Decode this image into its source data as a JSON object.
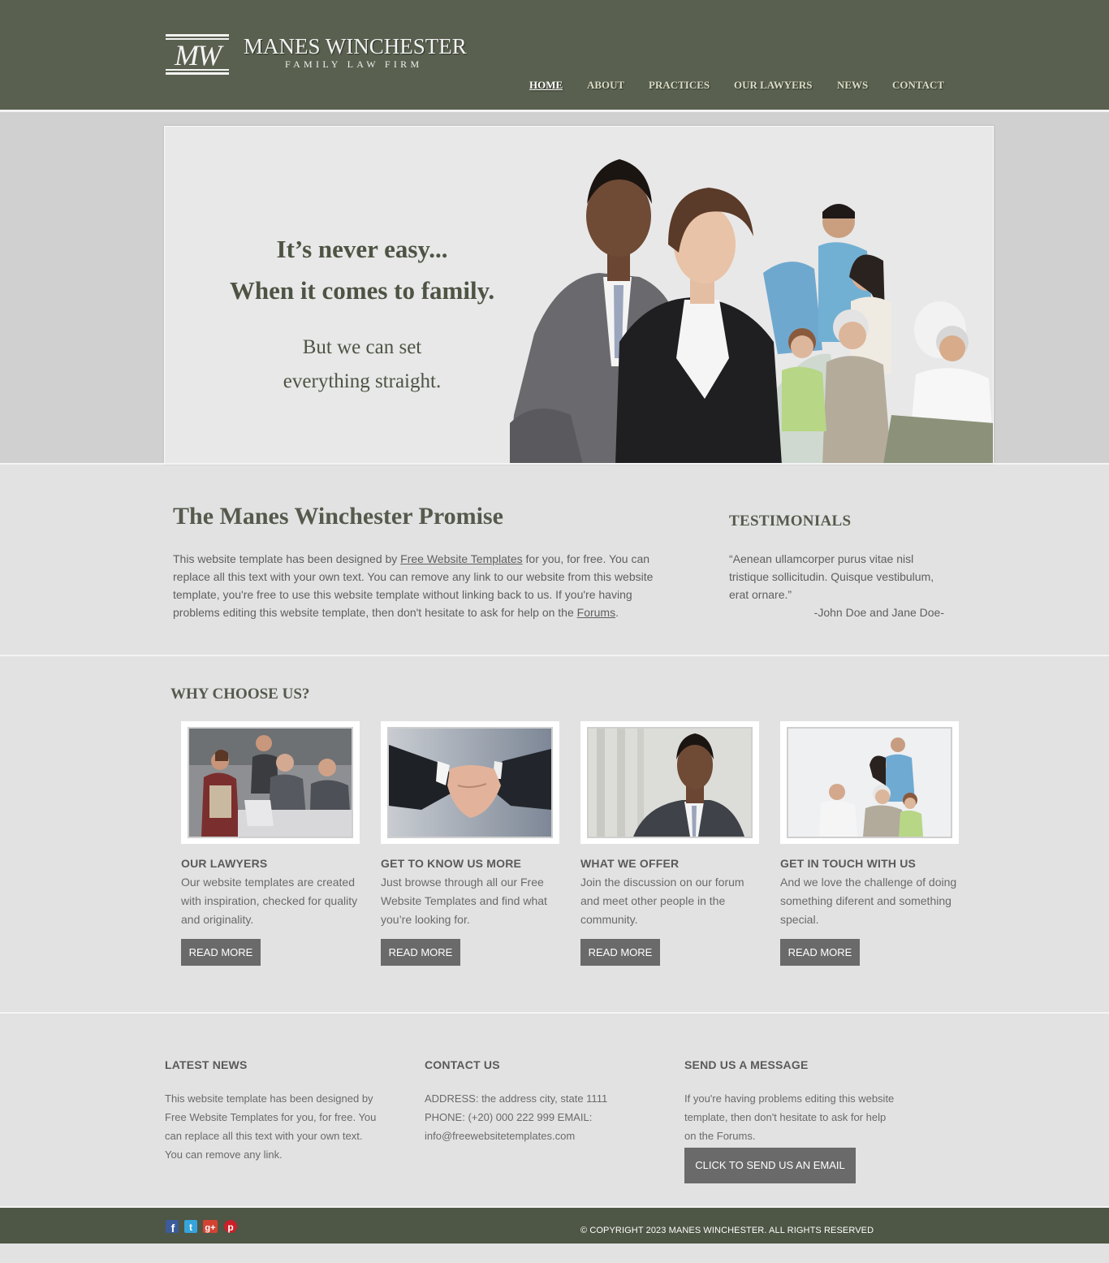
{
  "header": {
    "brand_name": "MANES WINCHESTER",
    "brand_tagline": "FAMILY LAW FIRM",
    "logo_monogram": "MW",
    "nav": [
      {
        "label": "HOME",
        "active": true
      },
      {
        "label": "ABOUT",
        "active": false
      },
      {
        "label": "PRACTICES",
        "active": false
      },
      {
        "label": "OUR LAWYERS",
        "active": false
      },
      {
        "label": "NEWS",
        "active": false
      },
      {
        "label": "CONTACT",
        "active": false
      }
    ]
  },
  "hero": {
    "line1": "It’s never easy...",
    "line2": "When it comes to family.",
    "line3": "But we can set",
    "line4": "everything straight."
  },
  "promise": {
    "title": "The Manes Winchester Promise",
    "text_before_link": "This website template has been designed by ",
    "link1": "Free Website Templates",
    "text_middle": " for you, for free. You can replace all this text with your own text. You can remove any link to our website from this website template, you're free to use this website template without linking back to us. If you're having problems editing this website template, then don't hesitate to ask for help on the ",
    "link2": "Forums",
    "text_after_link": "."
  },
  "testimonials": {
    "title": "TESTIMONIALS",
    "quote": "“Aenean ullamcorper purus vitae nisl tristique sollicitudin. Quisque vestibulum, erat ornare.”",
    "author": "-John Doe and Jane Doe-"
  },
  "why": {
    "title": "WHY CHOOSE US?",
    "cards": [
      {
        "title": "OUR LAWYERS",
        "text": "Our website templates are created with inspiration, checked for quality and originality.",
        "button": "READ MORE"
      },
      {
        "title": "GET TO KNOW US MORE",
        "text": "Just browse through all our Free Website Templates and find what you’re looking for.",
        "button": "READ MORE"
      },
      {
        "title": "WHAT WE OFFER",
        "text": "Join the discussion on our forum and meet other people in the community.",
        "button": "READ MORE"
      },
      {
        "title": "GET IN TOUCH WITH US",
        "text": "And we love the challenge of doing something diferent and something special.",
        "button": "READ MORE"
      }
    ]
  },
  "footer": {
    "news_title": "LATEST NEWS",
    "news_text": "This website template has been designed by Free Website Templates for you, for free. You can replace all this text with your own text. You can remove any link.",
    "contact_title": "CONTACT US",
    "contact_text": "ADDRESS: the address city, state 1111 PHONE: (+20) 000 222 999 EMAIL: info@freewebsitetemplates.com",
    "message_title": "SEND US A MESSAGE",
    "message_text": "If you're having problems editing this website template, then don't hesitate to ask for help on the Forums.",
    "email_button": "CLICK TO SEND US AN EMAIL",
    "social": [
      "facebook-icon",
      "twitter-icon",
      "google-plus-icon",
      "pinterest-icon"
    ],
    "copyright": "© COPYRIGHT 2023 MANES WINCHESTER. ALL RIGHTS RESERVED"
  },
  "colors": {
    "header_bg": "#59604f",
    "bottom_bar_bg": "#4e5645",
    "button_bg": "#6a6a6a",
    "page_bg": "#e2e2e2"
  }
}
